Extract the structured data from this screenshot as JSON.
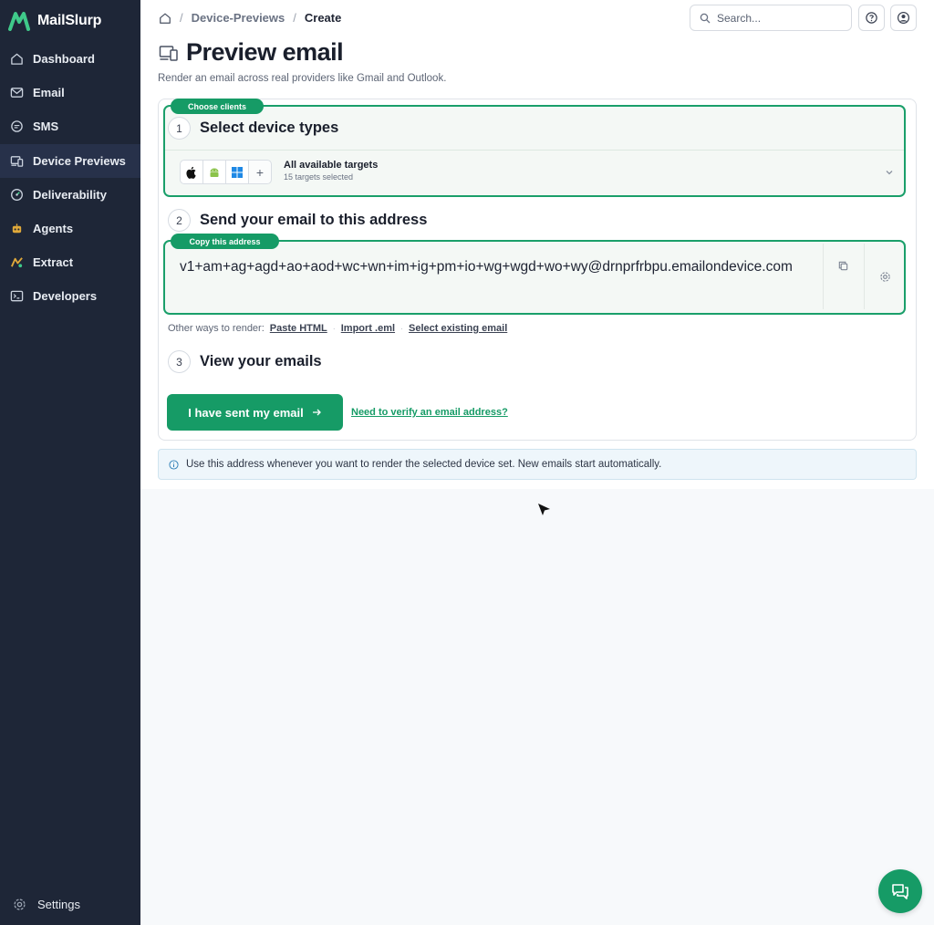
{
  "brand": {
    "name": "MailSlurp"
  },
  "sidebar": {
    "items": [
      {
        "label": "Dashboard",
        "icon": "home-icon"
      },
      {
        "label": "Email",
        "icon": "mail-icon"
      },
      {
        "label": "SMS",
        "icon": "chat-bubble-icon"
      },
      {
        "label": "Device Previews",
        "icon": "devices-icon",
        "active": true
      },
      {
        "label": "Deliverability",
        "icon": "gauge-icon"
      },
      {
        "label": "Agents",
        "icon": "robot-icon"
      },
      {
        "label": "Extract",
        "icon": "extract-icon"
      },
      {
        "label": "Developers",
        "icon": "terminal-icon"
      }
    ],
    "settings_label": "Settings"
  },
  "breadcrumb": {
    "section": "Device-Previews",
    "current": "Create"
  },
  "search": {
    "placeholder": "Search..."
  },
  "page": {
    "title": "Preview email",
    "subtitle": "Render an email across real providers like Gmail and Outlook."
  },
  "step1": {
    "pill": "Choose clients",
    "number": "1",
    "title": "Select device types",
    "targets_title": "All available targets",
    "targets_sub": "15 targets selected",
    "os_icons": [
      "apple-icon",
      "android-icon",
      "windows-icon",
      "plus-icon"
    ],
    "plus": "+"
  },
  "step2": {
    "number": "2",
    "title": "Send your email to this address",
    "pill": "Copy this address",
    "address": "v1+am+ag+agd+ao+aod+wc+wn+im+ig+pm+io+wg+wgd+wo+wy@drnprfrbpu.emailondevice.com"
  },
  "other_ways": {
    "label": "Other ways to render:",
    "links": [
      "Paste HTML",
      "Import .eml",
      "Select existing email"
    ]
  },
  "step3": {
    "number": "3",
    "title": "View your emails",
    "button": "I have sent my email",
    "verify_link": "Need to verify an email address?"
  },
  "info": {
    "text": "Use this address whenever you want to render the selected device set. New emails start automatically."
  },
  "colors": {
    "accent": "#169b66",
    "sidebar_bg": "#1e2637",
    "info_bg": "#eef6fb"
  }
}
